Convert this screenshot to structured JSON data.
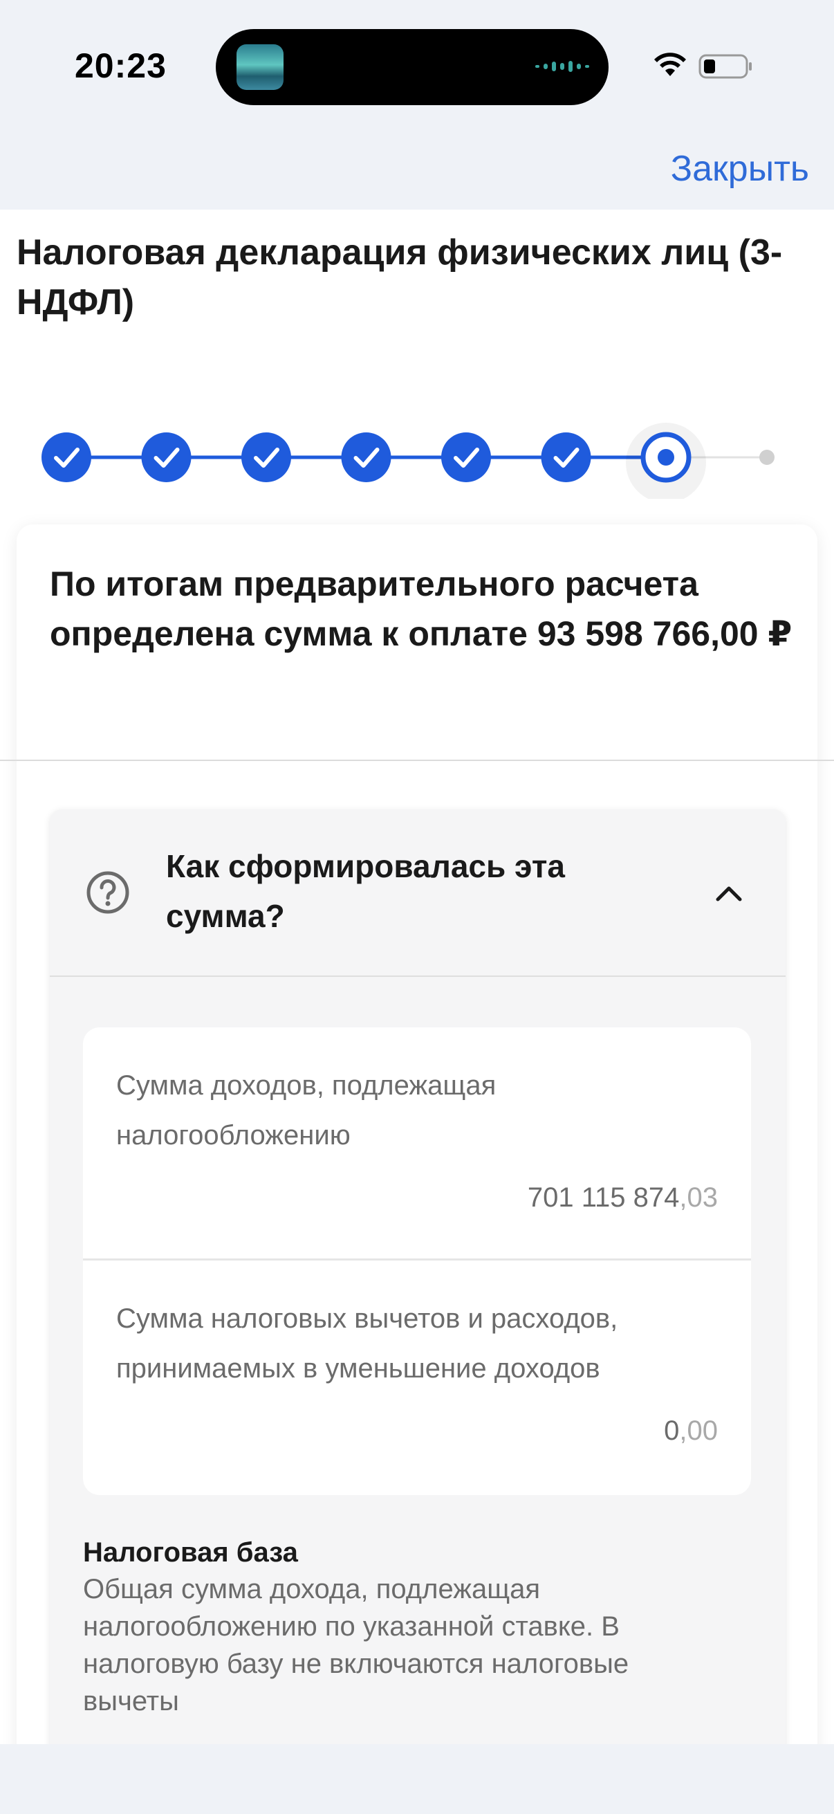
{
  "status_bar": {
    "time": "20:23"
  },
  "header": {
    "close_label": "Закрыть"
  },
  "page": {
    "title": "Налоговая декларация физических лиц (3-НДФЛ)"
  },
  "stepper": {
    "total_steps": 8,
    "completed_steps": 6,
    "current_step": 7,
    "accent_color": "#1f5bdc",
    "inactive_color": "#d0d0d0"
  },
  "summary": {
    "text": "По итогам предварительного расчета определена сумма к оплате 93 598 766,00 ₽"
  },
  "accordion": {
    "title": "Как сформировалась эта сумма?",
    "expanded": true,
    "items": [
      {
        "label": "Сумма доходов, подлежащая налогообложению",
        "value_int": "701 115 874",
        "value_frac": ",03"
      },
      {
        "label": "Сумма налоговых вычетов и расходов, принимаемых в уменьшение доходов",
        "value_int": "0",
        "value_frac": ",00"
      }
    ],
    "tax_base": {
      "title": "Налоговая база",
      "description": "Общая сумма дохода, подлежащая налогообложению по указанной ставке. В налоговую базу не включаются налоговые вычеты"
    }
  }
}
